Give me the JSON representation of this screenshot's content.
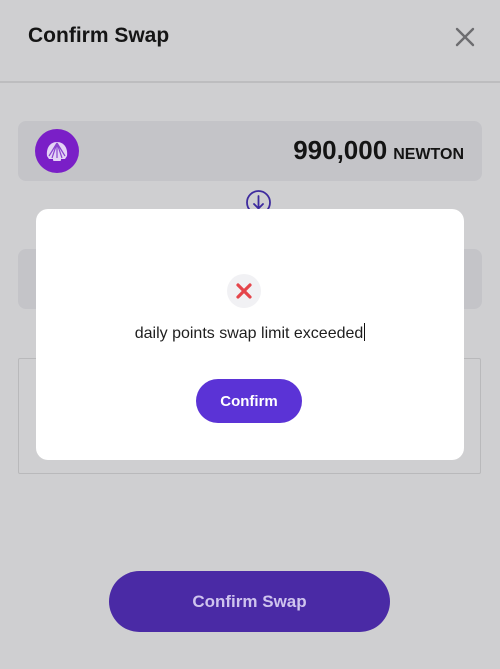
{
  "header": {
    "title": "Confirm Swap"
  },
  "from": {
    "amount": "990,000",
    "unit": "NEWTON",
    "logo_icon": "shell-icon"
  },
  "footer": {
    "confirm_swap_label": "Confirm Swap"
  },
  "modal": {
    "status_icon": "error-x-icon",
    "message": "daily points swap limit exceeded",
    "confirm_label": "Confirm"
  },
  "colors": {
    "accent": "#5b33d6",
    "error": "#e5454b",
    "token_logo": "#7a1fc7"
  }
}
